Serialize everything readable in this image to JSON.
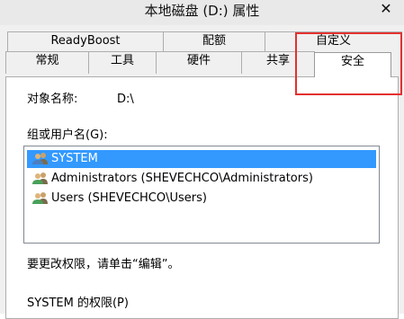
{
  "window": {
    "title": "本地磁盘 (D:) 属性",
    "close_glyph": "✕"
  },
  "tabs": {
    "row1": [
      "ReadyBoost",
      "配额",
      "自定义"
    ],
    "row2": [
      "常规",
      "工具",
      "硬件",
      "共享"
    ],
    "active": "安全"
  },
  "security": {
    "object_name_label": "对象名称:",
    "object_name_value": "D:\\",
    "group_label": "组或用户名(G):",
    "users": [
      "SYSTEM",
      "Administrators (SHEVECHCO\\Administrators)",
      "Users (SHEVECHCO\\Users)"
    ],
    "edit_hint": "要更改权限，请单击“编辑”。",
    "permissions_label": "SYSTEM 的权限(P)"
  },
  "colors": {
    "selection": "#3399ff",
    "annotation": "#e53030"
  },
  "icons": {
    "user": "users-icon"
  }
}
